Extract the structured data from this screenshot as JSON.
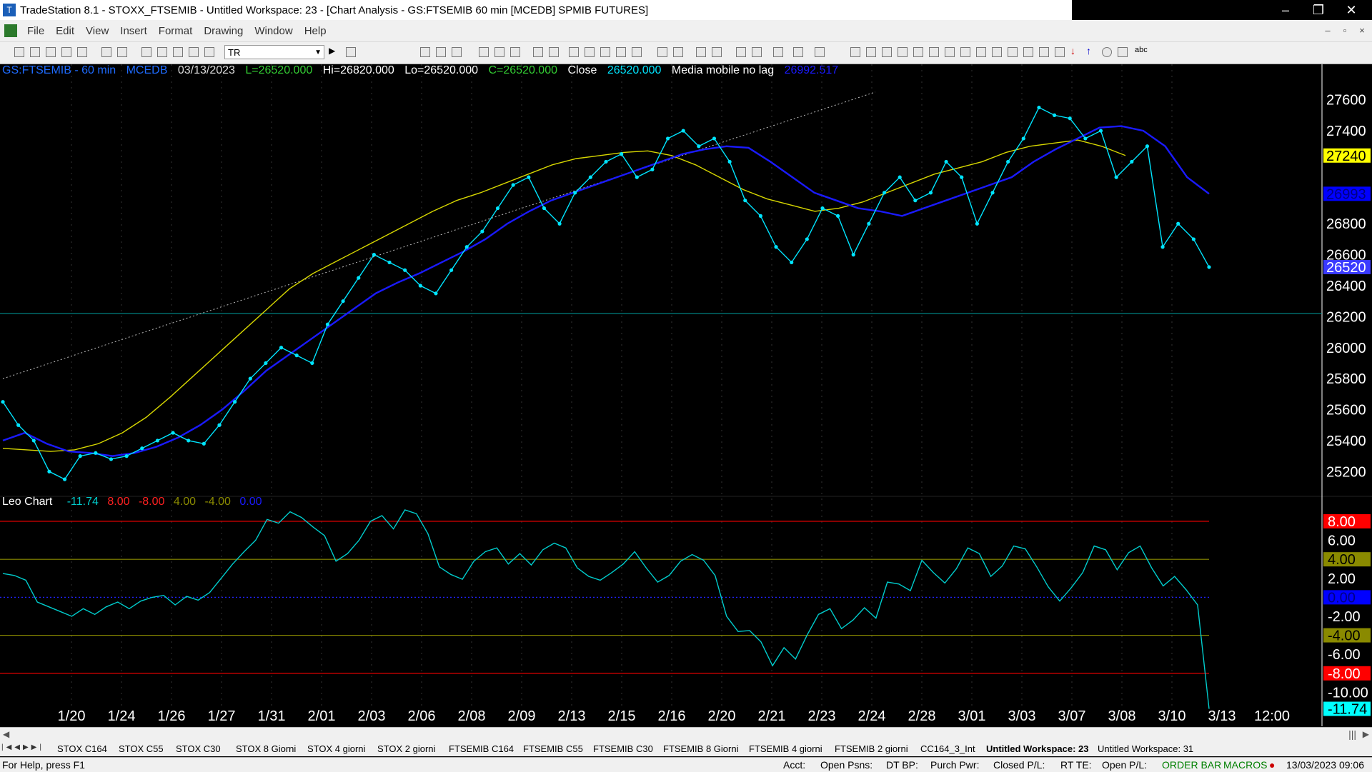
{
  "window": {
    "title": "TradeStation 8.1 - STOXX_FTSEMIB - Untitled Workspace:  23 - [Chart Analysis - GS:FTSEMIB  60 min  [MCEDB] SPMIB FUTURES]",
    "minimize": "‒",
    "restore": "❐",
    "close": "✕"
  },
  "menu": [
    "File",
    "Edit",
    "View",
    "Insert",
    "Format",
    "Drawing",
    "Window",
    "Help"
  ],
  "toolbar": {
    "symbol_value": "TR"
  },
  "chart_header": {
    "symbol": "GS:FTSEMIB - 60 min",
    "exchange": "MCEDB",
    "date": "03/13/2023",
    "low_field": "L=26520.000",
    "high_field": "Hi=26820.000",
    "lo_field": "Lo=26520.000",
    "close_field": "C=26520.000",
    "close_label": "Close",
    "close_value": "26520.000",
    "ma_label": "Media mobile no lag",
    "ma_value": "26992.517"
  },
  "sub_header": {
    "name": "Leo Chart",
    "v1": "-11.74",
    "v2": "8.00",
    "v3": "-8.00",
    "v4": "4.00",
    "v5": "-4.00",
    "v6": "0.00"
  },
  "colors": {
    "price_dots": "#00e5ff",
    "blue_ma": "#1a1aff",
    "yellow_ma": "#d6d600",
    "osc_line": "#00cccc",
    "red_level": "#ff0000",
    "olive_level": "#8a8a00"
  },
  "chart_data": [
    {
      "type": "line",
      "name": "price",
      "x_labels": [
        "1/20",
        "1/24",
        "1/26",
        "1/27",
        "1/31",
        "2/01",
        "2/03",
        "2/06",
        "2/08",
        "2/09",
        "2/13",
        "2/15",
        "2/16",
        "2/20",
        "2/21",
        "2/23",
        "2/24",
        "2/28",
        "3/01",
        "3/03",
        "3/07",
        "3/08",
        "3/10",
        "3/13",
        "12:00"
      ],
      "y_ticks": [
        27600,
        27400,
        27200,
        27000,
        26800,
        26600,
        26400,
        26200,
        26000,
        25800,
        25600,
        25400,
        25200
      ],
      "y_tick_labels": [
        "27600",
        "27400",
        "",
        "",
        "26800",
        "26600",
        "26400",
        "26200",
        "26000",
        "25800",
        "25600",
        "25400",
        "25200"
      ],
      "ylim": [
        25100,
        27700
      ],
      "price_labels": [
        {
          "value": 27240,
          "text": "27240",
          "bg": "#ffff00",
          "fg": "#000000"
        },
        {
          "value": 26993,
          "text": "26993",
          "bg": "#0000ff",
          "fg": "#000080"
        },
        {
          "value": 26520,
          "text": "26520",
          "bg": "#3a3aff",
          "fg": "#ffffff"
        }
      ],
      "horizontal_line": 26220,
      "series": [
        {
          "name": "price",
          "values": [
            25650,
            25500,
            25400,
            25200,
            25150,
            25300,
            25320,
            25280,
            25300,
            25350,
            25400,
            25450,
            25400,
            25380,
            25500,
            25650,
            25800,
            25900,
            26000,
            25950,
            25900,
            26150,
            26300,
            26450,
            26600,
            26550,
            26500,
            26400,
            26350,
            26500,
            26650,
            26750,
            26900,
            27050,
            27100,
            26900,
            26800,
            27000,
            27100,
            27200,
            27250,
            27100,
            27150,
            27350,
            27400,
            27300,
            27350,
            27200,
            26950,
            26850,
            26650,
            26550,
            26700,
            26900,
            26850,
            26600,
            26800,
            27000,
            27100,
            26950,
            27000,
            27200,
            27100,
            26800,
            27000,
            27200,
            27350,
            27550,
            27500,
            27480,
            27350,
            27400,
            27100,
            27200,
            27300,
            26650,
            26800,
            26700,
            26520
          ]
        },
        {
          "name": "",
          "values": [
            25400,
            25450,
            25380,
            25330,
            25320,
            25300,
            25320,
            25360,
            25420,
            25500,
            25600,
            25720,
            25850,
            25950,
            26050,
            26150,
            26250,
            26350,
            26420,
            26480,
            26550,
            26620,
            26700,
            26800,
            26880,
            26950,
            27000,
            27050,
            27100,
            27150,
            27200,
            27250,
            27280,
            27300,
            27290,
            27200,
            27100,
            27000,
            26950,
            26900,
            26880,
            26850,
            26900,
            26950,
            27000,
            27050,
            27100,
            27200,
            27280,
            27350,
            27420,
            27430,
            27400,
            27300,
            27100,
            26993
          ]
        },
        {
          "name": "",
          "values": [
            25350,
            25340,
            25330,
            25340,
            25380,
            25450,
            25550,
            25680,
            25820,
            25960,
            26100,
            26240,
            26380,
            26480,
            26560,
            26640,
            26720,
            26800,
            26880,
            26950,
            27000,
            27060,
            27120,
            27180,
            27220,
            27240,
            27260,
            27270,
            27240,
            27180,
            27100,
            27020,
            26960,
            26920,
            26880,
            26900,
            26940,
            27000,
            27060,
            27120,
            27160,
            27200,
            27260,
            27300,
            27320,
            27340,
            27300,
            27240
          ]
        }
      ]
    },
    {
      "type": "line",
      "name": "Leo Chart",
      "y_ticks": [
        8,
        6,
        4,
        2,
        0,
        -2,
        -4,
        -6,
        -8,
        -10,
        -11.74
      ],
      "y_tick_labels": [
        "8.00",
        "6.00",
        "4.00",
        "2.00",
        "0.00",
        "-2.00",
        "-4.00",
        "-6.00",
        "-8.00",
        "-10.00",
        "-11.74"
      ],
      "ylim": [
        -12,
        9.5
      ],
      "levels": [
        8,
        4,
        0,
        -4,
        -8
      ],
      "series": [
        {
          "name": "Leo Chart",
          "values": [
            2.5,
            2.3,
            1.8,
            -0.5,
            -1,
            -1.5,
            -2,
            -1.2,
            -1.8,
            -1,
            -0.5,
            -1.2,
            -0.4,
            0,
            0.2,
            -0.8,
            0.1,
            -0.3,
            0.5,
            2,
            3.5,
            4.8,
            6,
            8.2,
            7.8,
            9,
            8.4,
            7.4,
            6.5,
            3.8,
            4.6,
            6,
            8,
            8.6,
            7.2,
            9.2,
            8.8,
            6.7,
            3.2,
            2.4,
            1.9,
            3.8,
            4.8,
            5.2,
            3.5,
            4.6,
            3.4,
            5,
            5.7,
            5.2,
            3.1,
            2.2,
            1.8,
            2.6,
            3.5,
            4.8,
            3.1,
            1.6,
            2.3,
            3.8,
            4.5,
            3.9,
            2.3,
            -2,
            -3.6,
            -3.5,
            -4.7,
            -7.2,
            -5.3,
            -6.5,
            -4,
            -1.8,
            -1.2,
            -3.3,
            -2.4,
            -1.1,
            -2.2,
            1.6,
            1.4,
            0.7,
            3.9,
            2.6,
            1.5,
            3,
            5.2,
            4.6,
            2.2,
            3.3,
            5.4,
            5.1,
            3.2,
            1.1,
            -0.4,
            1,
            2.6,
            5.4,
            5,
            2.9,
            4.7,
            5.4,
            3.1,
            1.2,
            2.2,
            0.8,
            -0.8,
            -11.74
          ]
        }
      ]
    }
  ],
  "status": {
    "help": "For Help, press F1",
    "acct": "Acct:",
    "open_psns": "Open Psns:",
    "dt_bp": "DT BP:",
    "purch_pwr": "Purch Pwr:",
    "closed_pl": "Closed P/L:",
    "rt_te": "RT TE:",
    "open_pl": "Open P/L:",
    "order_bar": "ORDER BAR",
    "macros": "MACROS",
    "datetime": "13/03/2023 09:06"
  },
  "tabs": [
    "STOX C164",
    "STOX C55",
    "STOX  C30",
    "STOX  8 Giorni",
    "STOX 4 giorni",
    "STOX  2 giorni",
    "FTSEMIB C164",
    "FTSEMIB C55",
    "FTSEMIB C30",
    "FTSEMIB  8 Giorni",
    "FTSEMIB  4 giorni",
    "FTSEMIB  2 giorni",
    "CC164_3_Int",
    "Untitled Workspace:  23",
    "Untitled Workspace:  31"
  ]
}
